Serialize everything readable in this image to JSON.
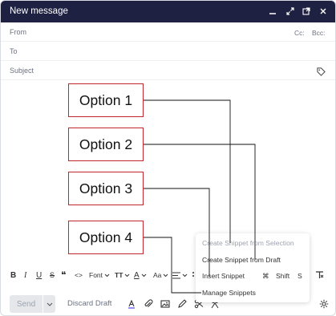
{
  "titlebar": {
    "title": "New message"
  },
  "fields": {
    "from_label": "From",
    "to_label": "To",
    "subject_label": "Subject",
    "cc_label": "Cc:",
    "bcc_label": "Bcc:"
  },
  "options": [
    "Option 1",
    "Option 2",
    "Option 3",
    "Option 4"
  ],
  "toolbar": {
    "bold": "B",
    "italic": "I",
    "underline": "U",
    "strike": "S",
    "quote": "❝",
    "code": "<>",
    "font": "Font",
    "size": "TT",
    "color": "A",
    "case": "Aa"
  },
  "snippet_menu": {
    "items": [
      "Create Snippet from Selection",
      "Create Snippet from Draft",
      "Insert Snippet",
      "Manage Snippets"
    ],
    "shortcut_cmd": "⌘",
    "shortcut_shift": "Shift",
    "shortcut_key": "S"
  },
  "bottom": {
    "send_label": "Send",
    "discard_label": "Discard Draft"
  },
  "colors": {
    "titlebar_bg": "#1f2142",
    "option_border": "#c0282d",
    "muted_text": "#6b7280"
  }
}
